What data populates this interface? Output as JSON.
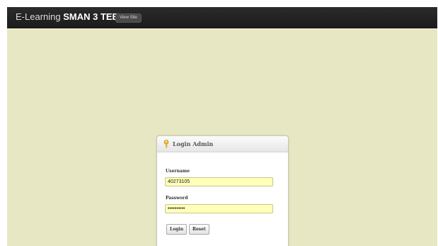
{
  "header": {
    "brand_prefix": "E-Learning ",
    "brand_name": "SMAN 3 TEBO",
    "view_site_label": "View Site"
  },
  "login": {
    "title": "Login Admin",
    "icon": "key-icon",
    "username_label": "Username",
    "username_value": "40273105",
    "password_label": "Password",
    "password_value": "••••••••••",
    "login_button": "Login",
    "reset_button": "Reset"
  },
  "colors": {
    "page_background": "#e8e7c4",
    "topbar": "#1c1c1c",
    "input_background": "#ffffb9"
  }
}
